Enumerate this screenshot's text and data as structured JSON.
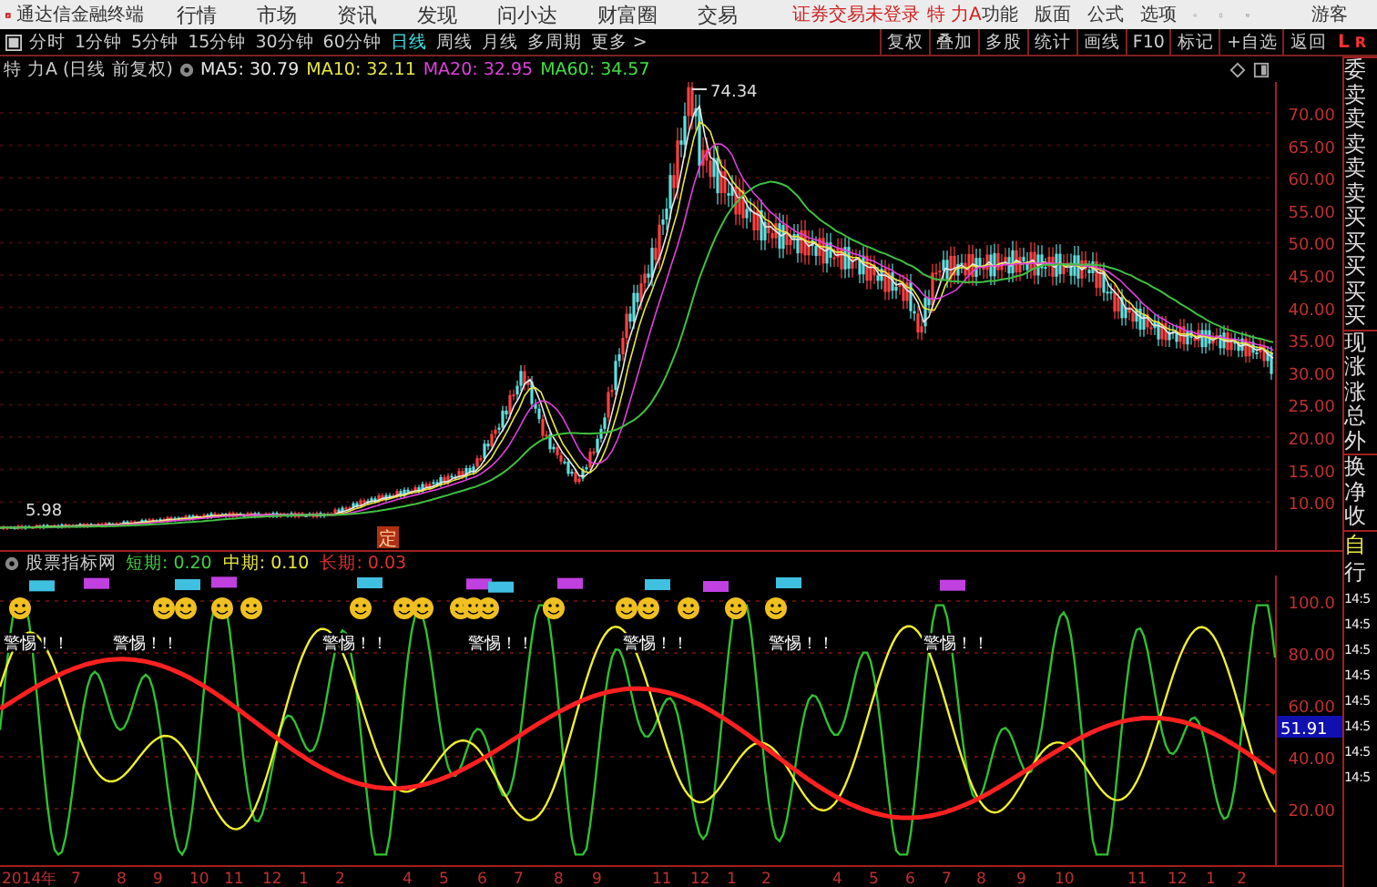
{
  "app": {
    "name": "通达信金融终端",
    "menu": [
      "行情",
      "市场",
      "资讯",
      "发现",
      "问小达",
      "财富圈",
      "交易"
    ],
    "login_status": "证券交易未登录",
    "stock": "特 力A",
    "right_menu": [
      "功能",
      "版面",
      "公式",
      "选项"
    ],
    "user": "游客"
  },
  "periods": [
    {
      "label": "分时",
      "selected": false
    },
    {
      "label": "1分钟",
      "selected": false
    },
    {
      "label": "5分钟",
      "selected": false
    },
    {
      "label": "15分钟",
      "selected": false
    },
    {
      "label": "30分钟",
      "selected": false
    },
    {
      "label": "60分钟",
      "selected": false
    },
    {
      "label": "日线",
      "selected": true
    },
    {
      "label": "周线",
      "selected": false
    },
    {
      "label": "月线",
      "selected": false
    },
    {
      "label": "多周期",
      "selected": false
    },
    {
      "label": "更多 >",
      "selected": false
    }
  ],
  "tools": [
    "复权",
    "叠加",
    "多股",
    "统计",
    "画线",
    "F10",
    "标记",
    "+自选",
    "返回"
  ],
  "panel_tabs": [
    "L",
    "R"
  ],
  "info": {
    "title": "特 力A (日线 前复权)",
    "ma": [
      {
        "label": "MA5: 30.79",
        "color": "#e8e8e8"
      },
      {
        "label": "MA10: 32.11",
        "color": "#e8e840"
      },
      {
        "label": "MA20: 32.95",
        "color": "#e040e0"
      },
      {
        "label": "MA60: 34.57",
        "color": "#40e040"
      }
    ]
  },
  "price_axis": [
    "70.00",
    "65.00",
    "60.00",
    "55.00",
    "50.00",
    "45.00",
    "40.00",
    "35.00",
    "30.00",
    "25.00",
    "20.00",
    "15.00",
    "10.00"
  ],
  "annotations": {
    "high": "74.34",
    "low": "5.98",
    "marker": "定"
  },
  "quote_labels": [
    "委",
    "卖",
    "卖",
    "卖",
    "卖",
    "卖",
    "买",
    "买",
    "买",
    "买",
    "买",
    "现",
    "涨",
    "涨",
    "总",
    "外",
    "换",
    "净",
    "收"
  ],
  "indicator": {
    "name": "股票指标网",
    "params": [
      {
        "label": "短期:",
        "value": "0.20",
        "color": "#40d040"
      },
      {
        "label": "中期:",
        "value": "0.10",
        "color": "#e8e840"
      },
      {
        "label": "长期:",
        "value": "0.03",
        "color": "#e03030"
      }
    ]
  },
  "signals": [
    "警惕！！",
    "警惕！！",
    "警惕！！",
    "警惕！！",
    "警惕！！",
    "警惕！！",
    "警惕！！"
  ],
  "indicator_axis": [
    "100.0",
    "80.00",
    "60.00",
    "40.00",
    "20.00"
  ],
  "current_value": "51.91",
  "side_labels": [
    "自",
    "行"
  ],
  "times": [
    "14:5",
    "14:5",
    "14:5",
    "14:5",
    "14:5",
    "14:5",
    "14:5",
    "14:5"
  ],
  "date_axis": [
    "2014年",
    "7",
    "8",
    "9",
    "10",
    "11",
    "12",
    "1",
    "2",
    "4",
    "5",
    "6",
    "7",
    "8",
    "9",
    "11",
    "12",
    "1",
    "2",
    "4",
    "5",
    "6",
    "7",
    "8",
    "9",
    "10",
    "11",
    "12",
    "1",
    "2"
  ]
}
